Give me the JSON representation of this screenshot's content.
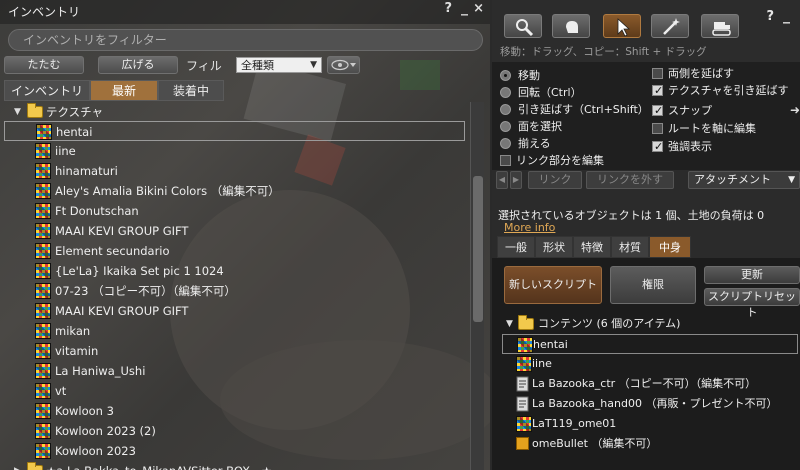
{
  "inventory": {
    "title": "インベントリ",
    "help": "?",
    "minimize": "_",
    "close": "×",
    "filter_placeholder": "インベントリをフィルター",
    "collapse_label": "たたむ",
    "expand_label": "広げる",
    "filter_label": "フィル",
    "type_select": "全種類",
    "tabs": [
      "インベントリ",
      "最新",
      "装着中"
    ],
    "folder": "テクスチャ",
    "items": [
      "hentai",
      "iine",
      "hinamaturi",
      "Aley's Amalia Bikini Colors （編集不可）",
      "Ft Donutschan",
      "MAAI KEVI GROUP GIFT",
      "Element secundario",
      "{Le'La} Ikaika Set pic 1 1024",
      "07-23 （コピー不可）（編集不可）",
      "MAAI KEVI GROUP GIFT",
      "mikan",
      "vitamin",
      "La Haniwa_Ushi",
      "vt",
      "Kowloon 3",
      "Kowloon 2023 (2)",
      "Kowloon 2023"
    ],
    "partial_folder": "★a La Bakka_to_MikanAVSitter BOX - ★"
  },
  "tools": {
    "help": "?",
    "minimize": "_",
    "hint": "移動：ドラッグ、コピー：Shift + ドラッグ",
    "radios": [
      "移動",
      "回転（Ctrl）",
      "引き延ばす（Ctrl+Shift）",
      "面を選択",
      "揃える"
    ],
    "edit_link_parts": "リンク部分を編集",
    "checks": [
      {
        "label": "両側を延ばす",
        "checked": false
      },
      {
        "label": "テクスチャを引き延ばす",
        "checked": true
      },
      {
        "label": "スナップ",
        "checked": true
      },
      {
        "label": "ルートを軸に編集",
        "checked": false
      },
      {
        "label": "強調表示",
        "checked": true
      }
    ],
    "link_label": "リンク",
    "unlink_label": "リンクを外す",
    "attachment_label": "アタッチメント",
    "selection_info": "選択されているオブジェクトは 1 個、土地の負荷は 0",
    "more_info": "More info",
    "tabs": [
      "一般",
      "形状",
      "特徴",
      "材質",
      "中身"
    ],
    "new_script": "新しいスクリプト",
    "permissions": "権限",
    "refresh": "更新",
    "reset_scripts": "スクリプトリセット",
    "contents_folder": "コンテンツ (6 個のアイテム)",
    "contents": [
      {
        "label": "hentai",
        "icon": "texture"
      },
      {
        "label": "iine",
        "icon": "texture"
      },
      {
        "label": "La Bazooka_ctr （コピー不可）（編集不可）",
        "icon": "script"
      },
      {
        "label": "La Bazooka_hand00 （再販・プレゼント不可）",
        "icon": "script"
      },
      {
        "label": "LaT119_ome01",
        "icon": "texture"
      },
      {
        "label": "omeBullet （編集不可）",
        "icon": "object"
      }
    ]
  }
}
